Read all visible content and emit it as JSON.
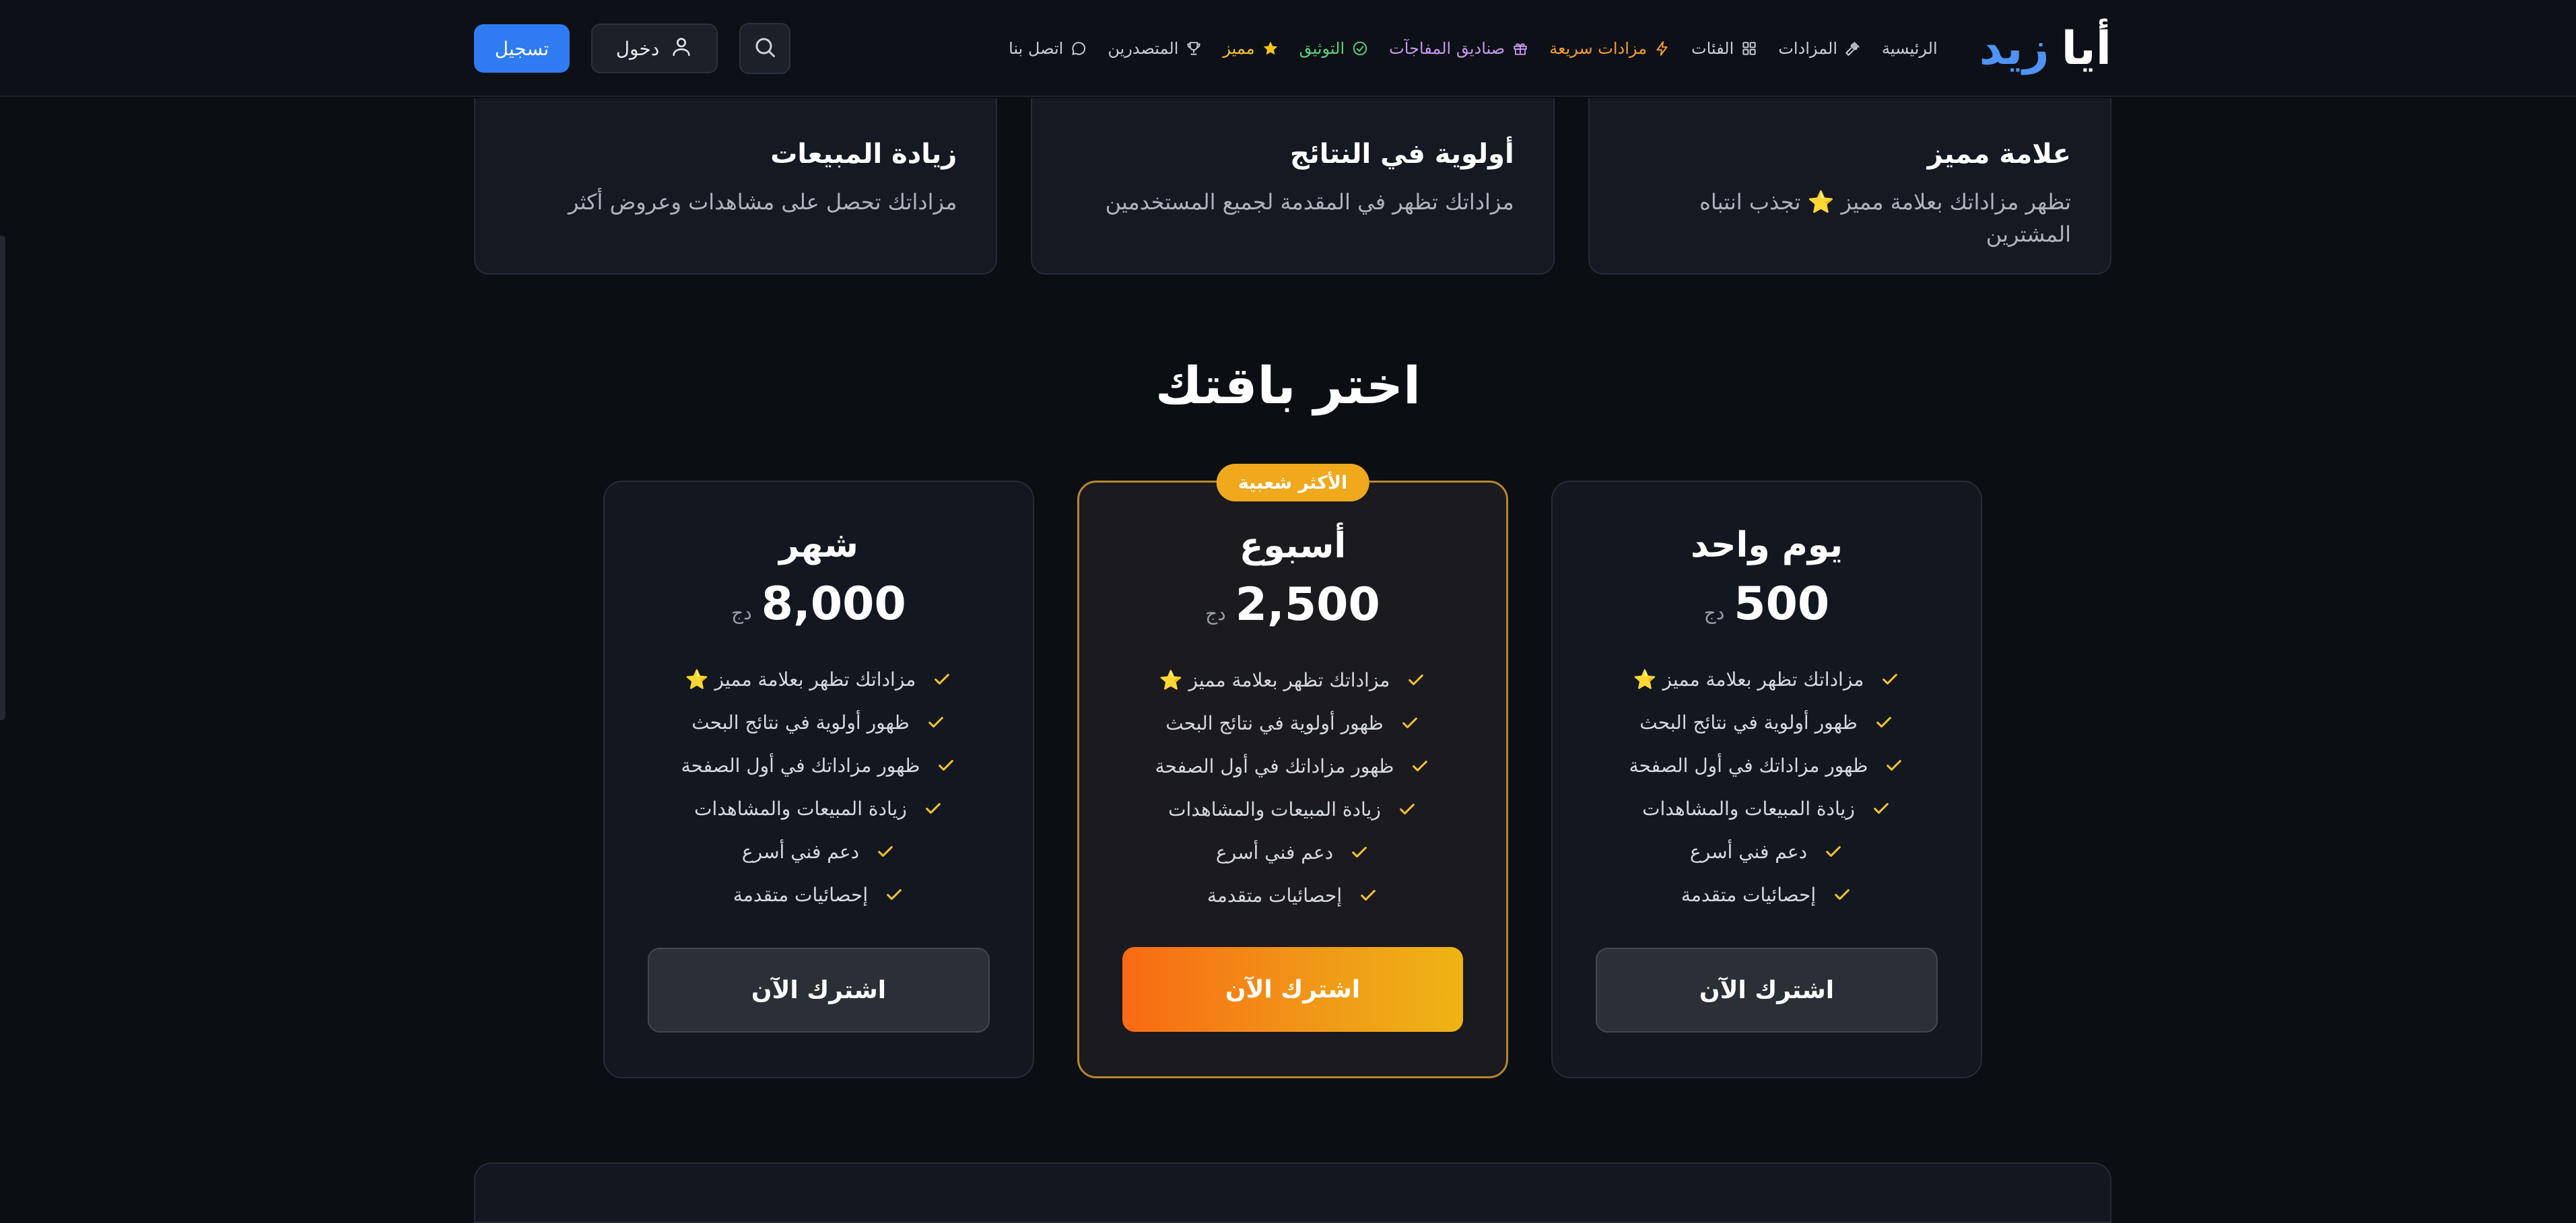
{
  "brand": {
    "word1": "أيا",
    "word2": "زيد",
    "accent_color": "#4e93f5"
  },
  "nav": {
    "links": [
      {
        "label": "الرئيسية",
        "icon": "",
        "color": "default"
      },
      {
        "label": "المزادات",
        "icon": "gavel-icon",
        "color": "default"
      },
      {
        "label": "الفئات",
        "icon": "grid-icon",
        "color": "default"
      },
      {
        "label": "مزادات سريعة",
        "icon": "lightning-icon",
        "color": "orange"
      },
      {
        "label": "صناديق المفاجآت",
        "icon": "gift-icon",
        "color": "purple"
      },
      {
        "label": "التوثيق",
        "icon": "check-circle-icon",
        "color": "green"
      },
      {
        "label": "مميز",
        "icon": "star-icon",
        "color": "gold"
      },
      {
        "label": "المتصدرين",
        "icon": "trophy-icon",
        "color": "default"
      },
      {
        "label": "اتصل بنا",
        "icon": "chat-icon",
        "color": "default"
      }
    ],
    "search_icon": "search-icon",
    "login_label": "دخول",
    "login_icon": "user-icon",
    "register_label": "تسجيل"
  },
  "features": [
    {
      "title": "علامة مميز",
      "description": "تظهر مزاداتك بعلامة مميز ⭐ تجذب انتباه المشترين"
    },
    {
      "title": "أولوية في النتائج",
      "description": "مزاداتك تظهر في المقدمة لجميع المستخدمين"
    },
    {
      "title": "زيادة المبيعات",
      "description": "مزاداتك تحصل على مشاهدات وعروض أكثر"
    }
  ],
  "plans_section": {
    "title": "اختر باقتك",
    "plans": [
      {
        "name": "يوم واحد",
        "price": "500",
        "currency": "دج",
        "featured": false,
        "badge": "",
        "features": [
          "مزاداتك تظهر بعلامة مميز ⭐",
          "ظهور أولوية في نتائج البحث",
          "ظهور مزاداتك في أول الصفحة",
          "زيادة المبيعات والمشاهدات",
          "دعم فني أسرع",
          "إحصائيات متقدمة"
        ],
        "button_label": "اشترك الآن"
      },
      {
        "name": "أسبوع",
        "price": "2,500",
        "currency": "دج",
        "featured": true,
        "badge": "الأكثر شعبية",
        "features": [
          "مزاداتك تظهر بعلامة مميز ⭐",
          "ظهور أولوية في نتائج البحث",
          "ظهور مزاداتك في أول الصفحة",
          "زيادة المبيعات والمشاهدات",
          "دعم فني أسرع",
          "إحصائيات متقدمة"
        ],
        "button_label": "اشترك الآن"
      },
      {
        "name": "شهر",
        "price": "8,000",
        "currency": "دج",
        "featured": false,
        "badge": "",
        "features": [
          "مزاداتك تظهر بعلامة مميز ⭐",
          "ظهور أولوية في نتائج البحث",
          "ظهور مزاداتك في أول الصفحة",
          "زيادة المبيعات والمشاهدات",
          "دعم فني أسرع",
          "إحصائيات متقدمة"
        ],
        "button_label": "اشترك الآن"
      }
    ]
  },
  "colors": {
    "background": "#0b0e13",
    "primary_blue": "#2f7bf2",
    "check": "#f1c232",
    "featured_border": "#b8862a",
    "badge": "#f0a81c"
  }
}
